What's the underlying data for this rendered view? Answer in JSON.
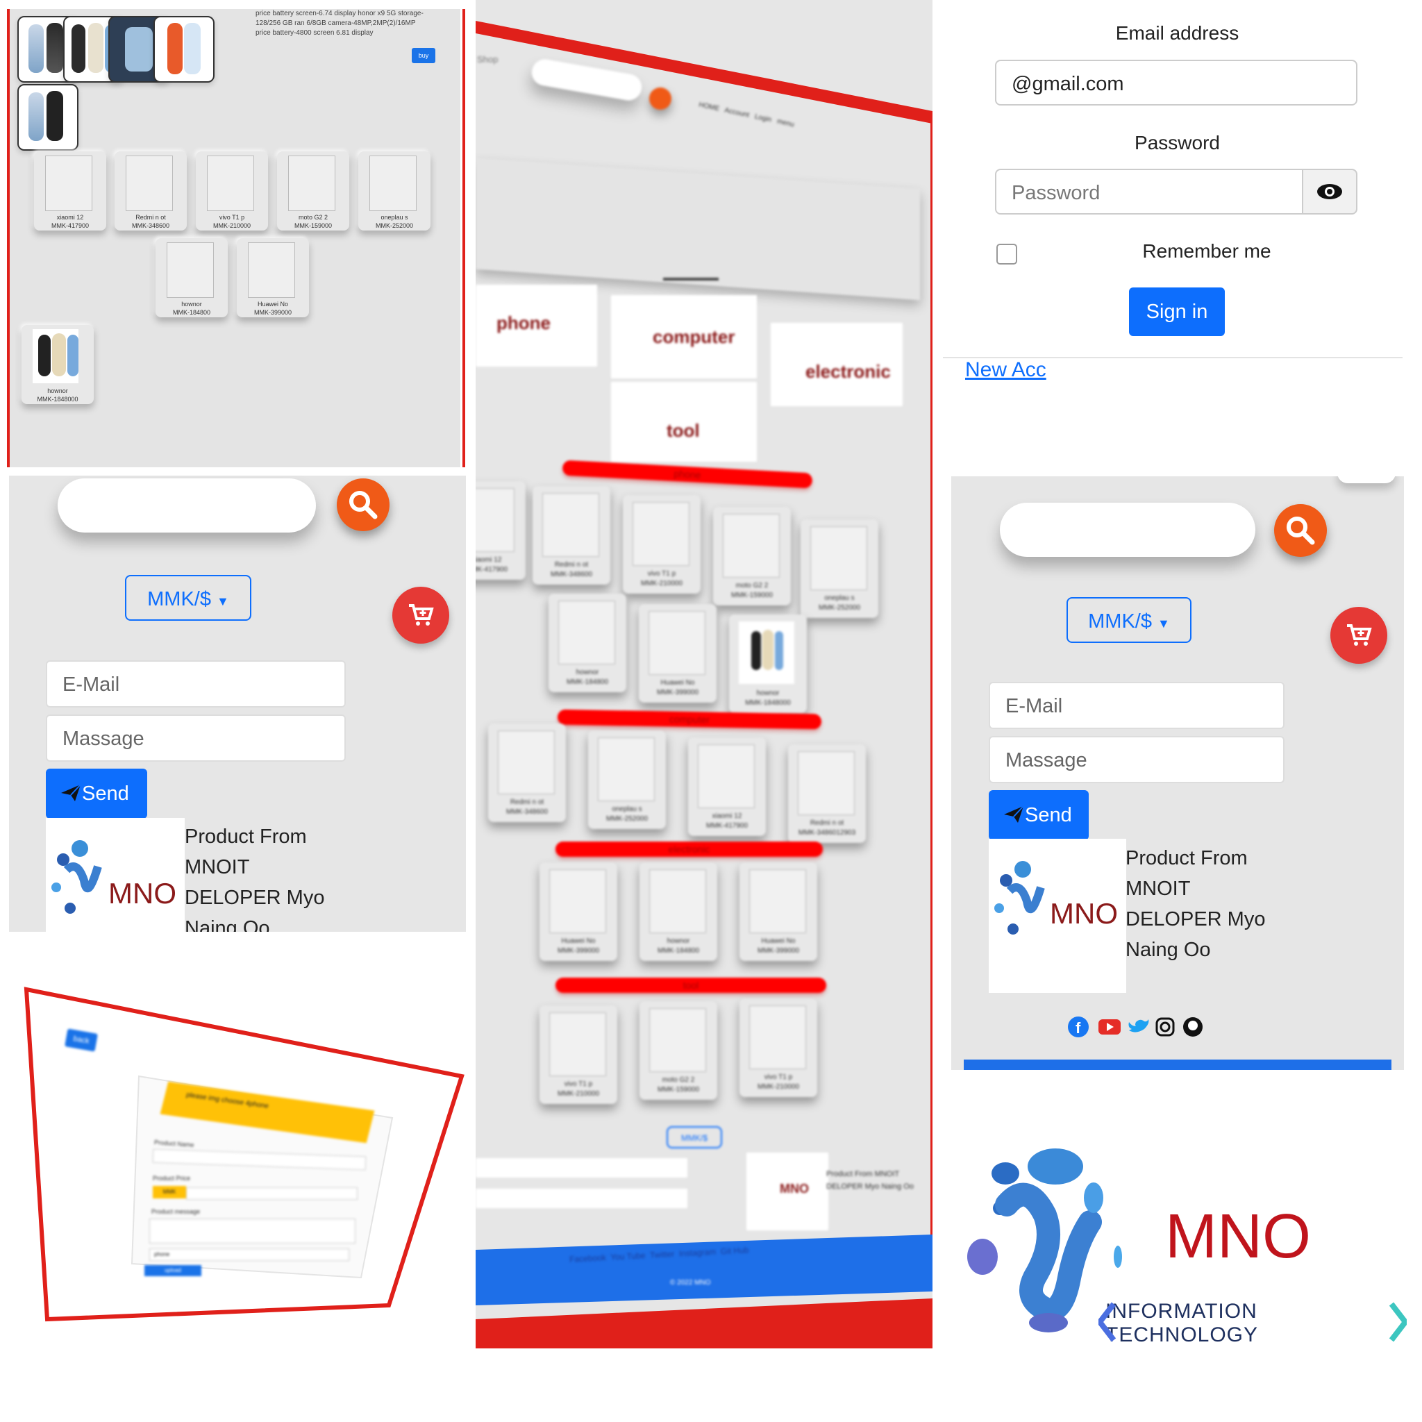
{
  "colors": {
    "accent": "#0d6efd",
    "brand_red": "#e0201a",
    "search_orange": "#f05a17",
    "logo_red": "#8b1a1a"
  },
  "detail": {
    "spec_lines": [
      "price battery screen-6.74 display honor x9 5G storage-",
      "128/256 GB ran 6/8GB camera-48MP,2MP(2)/16MP",
      "price battery-4800 screen 6.81 display"
    ],
    "buy_label": "buy",
    "products": [
      {
        "name": "xiaomi 12",
        "price": "MMK-417900"
      },
      {
        "name": "Redmi n ot",
        "price": "MMK-348600"
      },
      {
        "name": "vivo T1 p",
        "price": "MMK-210000"
      },
      {
        "name": "moto G2 2",
        "price": "MMK-159000"
      },
      {
        "name": "oneplau s",
        "price": "MMK-252000"
      },
      {
        "name": "hownor",
        "price": "MMK-184800"
      },
      {
        "name": "Huawei No",
        "price": "MMK-399000"
      },
      {
        "name": "hownor",
        "price": "MMK-1848000"
      }
    ]
  },
  "shop": {
    "title": "Shop",
    "nav": [
      "HOME",
      "Account",
      "Login",
      "menu"
    ],
    "logo_labels": [
      "phone",
      "computer",
      "electronic",
      "tool"
    ],
    "logo_word": "MNO",
    "categories": [
      "phone",
      "computer",
      "electronic",
      "tool"
    ],
    "phone_products": [
      {
        "name": "xiaomi 12",
        "price": "MMK-417900"
      },
      {
        "name": "Redmi n ot",
        "price": "MMK-348600"
      },
      {
        "name": "vivo T1 p",
        "price": "MMK-210000"
      },
      {
        "name": "moto G2 2",
        "price": "MMK-159000"
      },
      {
        "name": "oneplau s",
        "price": "MMK-252000"
      },
      {
        "name": "hownor",
        "price": "MMK-184800"
      },
      {
        "name": "Huawei No",
        "price": "MMK-399000"
      },
      {
        "name": "hownor",
        "price": "MMK-1848000"
      }
    ],
    "computer_products": [
      {
        "name": "Redmi n ot",
        "price": "MMK-348600"
      },
      {
        "name": "oneplau s",
        "price": "MMK-252000"
      },
      {
        "name": "xiaomi 12",
        "price": "MMK-417900"
      },
      {
        "name": "Redmi n ot",
        "price": "MMK-3486012903"
      }
    ],
    "electronic_products": [
      {
        "name": "Huawei No",
        "price": "MMK-399000"
      },
      {
        "name": "hownor",
        "price": "MMK-184800"
      },
      {
        "name": "Huawei No",
        "price": "MMK-399000"
      }
    ],
    "tool_products": [
      {
        "name": "vivo T1 p",
        "price": "MMK-210000"
      },
      {
        "name": "moto G2 2",
        "price": "MMK-159000"
      },
      {
        "name": "vivo T1 p",
        "price": "MMK-210000"
      }
    ],
    "currency": "MMK/$",
    "footer_text": "Product From MNOIT DELOPER Myo Naing Oo",
    "social": [
      "Facebook",
      "You Tube",
      "Twitter",
      "Instagram",
      "Git Hub"
    ],
    "copyright": "© 2022 MNO"
  },
  "signin": {
    "email_label": "Email address",
    "email_value": "@gmail.com",
    "password_label": "Password",
    "password_placeholder": "Password",
    "remember_label": "Remember me",
    "signin_label": "Sign in",
    "new_account_link": "New Acc"
  },
  "contact": {
    "currency": "MMK/$",
    "email_placeholder": "E-Mail",
    "message_placeholder": "Massage",
    "send_label": "Send",
    "product_from_lines": [
      "Product From",
      "MNOIT",
      "DELOPER Myo",
      "Naing Oo"
    ]
  },
  "upload": {
    "back_label": "back",
    "alert_text": "please img choose 4phone",
    "product_name_label": "Product Name",
    "product_price_label": "Product Price",
    "currency_btn": "MMK",
    "product_message_label": "Product message",
    "category_value": "phone",
    "upload_label": "upload"
  },
  "brand": {
    "name": "MNO",
    "tagline": "INFORMATION TECHNOLOGY"
  },
  "social_icons": [
    "facebook-icon",
    "youtube-icon",
    "twitter-icon",
    "instagram-icon",
    "github-icon"
  ]
}
